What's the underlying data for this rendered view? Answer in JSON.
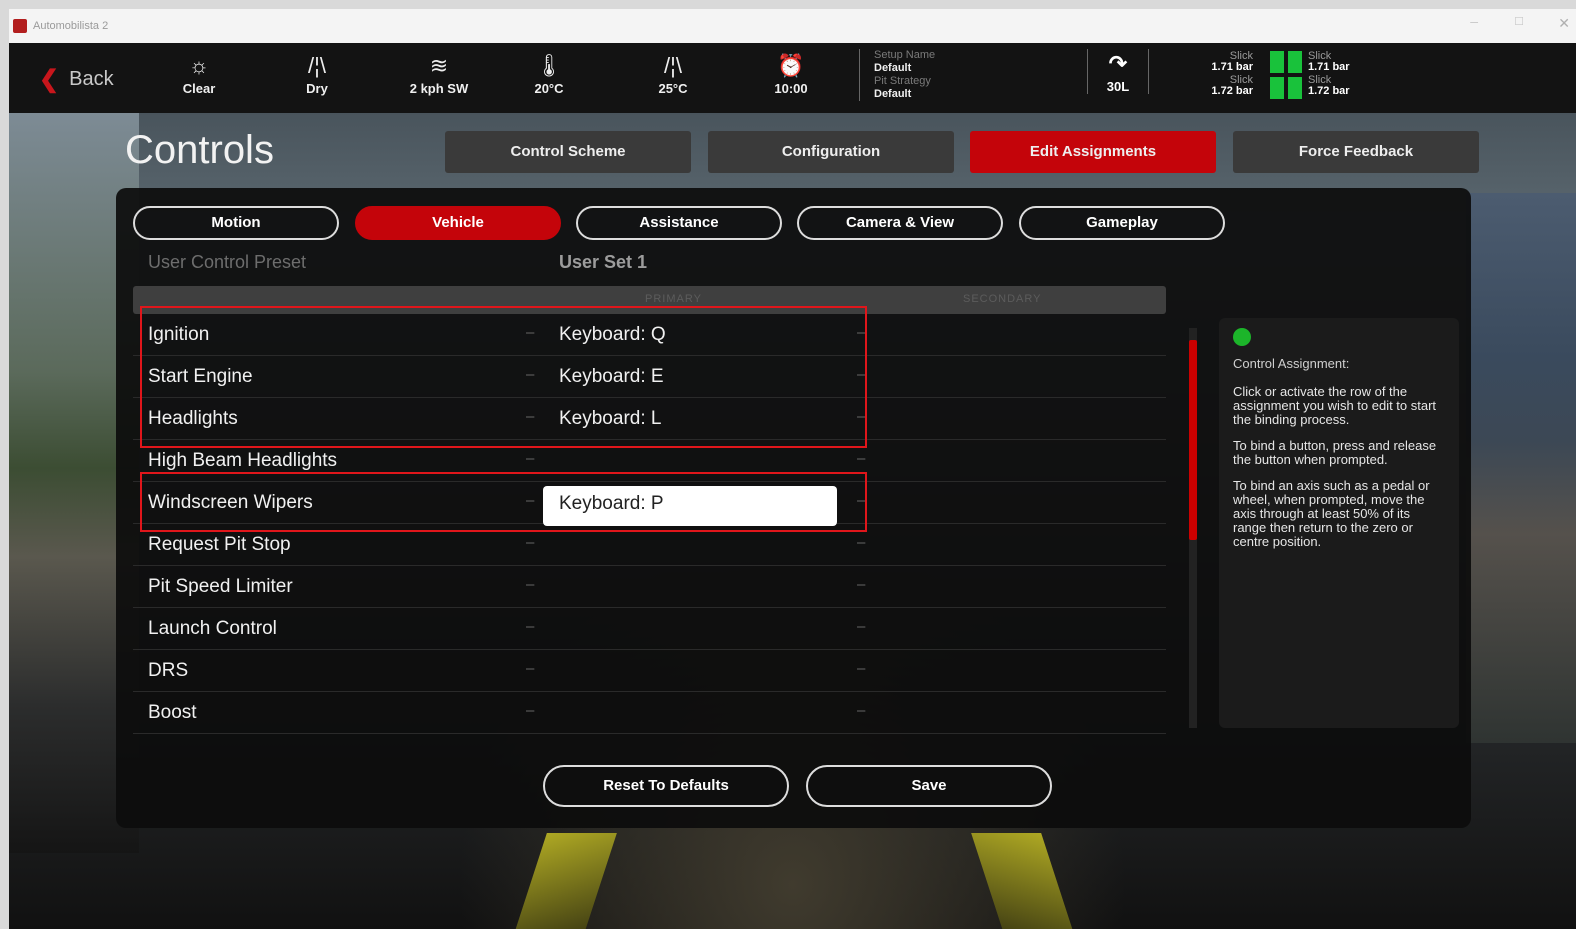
{
  "window": {
    "title": "Automobilista 2"
  },
  "topbar": {
    "back_label": "Back",
    "stats": [
      {
        "icon": "sun-icon",
        "glyph": "☼",
        "label": "Clear"
      },
      {
        "icon": "road-icon",
        "glyph": "/¦\\",
        "label": "Dry"
      },
      {
        "icon": "wind-icon",
        "glyph": "≋",
        "label": "2 kph SW"
      },
      {
        "icon": "thermometer-icon",
        "glyph": "🌡",
        "label": "20°C"
      },
      {
        "icon": "track-temp-icon",
        "glyph": "/¦\\",
        "label": "25°C"
      },
      {
        "icon": "clock-icon",
        "glyph": "⏰",
        "label": "10:00"
      }
    ],
    "setup": {
      "setup_name_label": "Setup Name",
      "setup_name_value": "Default",
      "pit_strategy_label": "Pit Strategy",
      "pit_strategy_value": "Default"
    },
    "fuel": {
      "icon": "fuel-gauge-icon",
      "value": "30L"
    },
    "tyres": {
      "fl_compound": "Slick",
      "fl_pressure": "1.71 bar",
      "fr_compound": "Slick",
      "fr_pressure": "1.71 bar",
      "rl_compound": "Slick",
      "rl_pressure": "1.72 bar",
      "rr_compound": "Slick",
      "rr_pressure": "1.72 bar",
      "status_color": "#19c23b"
    }
  },
  "page": {
    "title": "Controls"
  },
  "tabs": [
    {
      "label": "Control Scheme"
    },
    {
      "label": "Configuration"
    },
    {
      "label": "Edit Assignments"
    },
    {
      "label": "Force Feedback"
    }
  ],
  "subtabs": [
    {
      "label": "Motion"
    },
    {
      "label": "Vehicle"
    },
    {
      "label": "Assistance"
    },
    {
      "label": "Camera & View"
    },
    {
      "label": "Gameplay"
    }
  ],
  "preset": {
    "label": "User Control Preset",
    "value": "User Set 1"
  },
  "columns": {
    "primary": "PRIMARY",
    "secondary": "SECONDARY"
  },
  "assignments": [
    {
      "name": "Ignition",
      "dash1": "–",
      "primary": "Keyboard: Q",
      "dash2": "–"
    },
    {
      "name": "Start Engine",
      "dash1": "–",
      "primary": "Keyboard: E",
      "dash2": "–"
    },
    {
      "name": "Headlights",
      "dash1": "–",
      "primary": "Keyboard: L",
      "dash2": "–"
    },
    {
      "name": "High Beam Headlights",
      "dash1": "–",
      "primary": "",
      "dash2": "–"
    },
    {
      "name": "Windscreen Wipers",
      "dash1": "–",
      "primary": "Keyboard: P",
      "dash2": "–"
    },
    {
      "name": "Request Pit Stop",
      "dash1": "–",
      "primary": "",
      "dash2": "–"
    },
    {
      "name": "Pit Speed Limiter",
      "dash1": "–",
      "primary": "",
      "dash2": "–"
    },
    {
      "name": "Launch Control",
      "dash1": "–",
      "primary": "",
      "dash2": "–"
    },
    {
      "name": "DRS",
      "dash1": "–",
      "primary": "",
      "dash2": "–"
    },
    {
      "name": "Boost",
      "dash1": "–",
      "primary": "",
      "dash2": "–"
    }
  ],
  "help": {
    "heading": "Control Assignment:",
    "p1": "Click or activate the row of the assignment you wish to edit to start the binding process.",
    "p2": "To bind a button, press and release the button when prompted.",
    "p3": "To bind an axis such as a pedal or wheel, when prompted, move the axis through at least 50% of its range then return to the zero or centre position."
  },
  "buttons": {
    "reset": "Reset To Defaults",
    "save": "Save"
  },
  "colors": {
    "accent": "#c4040a",
    "highlight_frame": "#e0161b"
  }
}
